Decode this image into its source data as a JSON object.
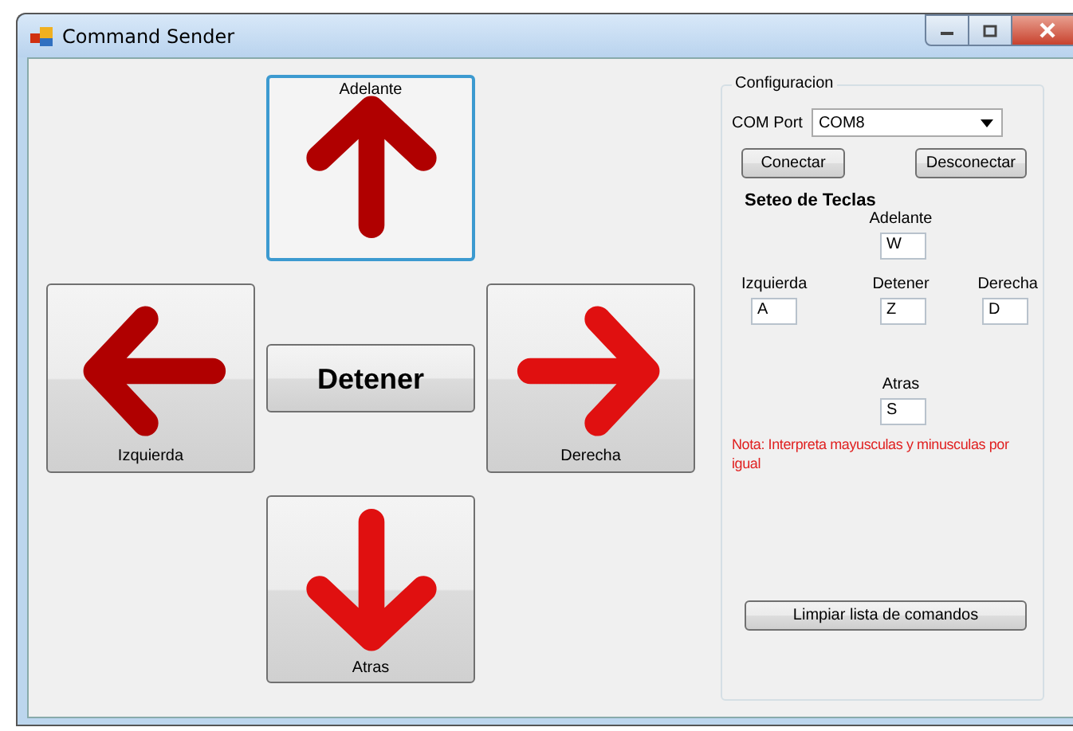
{
  "window": {
    "title": "Command Sender"
  },
  "pad": [
    {
      "kind": "up",
      "label": "Adelante",
      "color": "#b00000",
      "focused": true
    },
    {
      "kind": "left",
      "label": "Izquierda",
      "color": "#b00000",
      "focused": false
    },
    {
      "kind": "stop",
      "label": "Detener",
      "focused": false
    },
    {
      "kind": "right",
      "label": "Derecha",
      "color": "#e01010",
      "focused": false
    },
    {
      "kind": "down",
      "label": "Atras",
      "color": "#e01010",
      "focused": false
    }
  ],
  "config": {
    "title": "Configuracion",
    "port_label": "COM Port",
    "port_value": "COM8",
    "buttons": [
      "Conectar",
      "Desconectar"
    ],
    "keys_title": "Seteo de Teclas",
    "keys": [
      {
        "kind": "up",
        "label": "Adelante",
        "value": "W"
      },
      {
        "kind": "left",
        "label": "Izquierda",
        "value": "A"
      },
      {
        "kind": "stop",
        "label": "Detener",
        "value": "Z"
      },
      {
        "kind": "right",
        "label": "Derecha",
        "value": "D"
      },
      {
        "kind": "down",
        "label": "Atras",
        "value": "S"
      }
    ],
    "note": "Nota: Interpreta mayusculas y minusculas por igual",
    "clear_button": "Limpiar lista de comandos"
  }
}
